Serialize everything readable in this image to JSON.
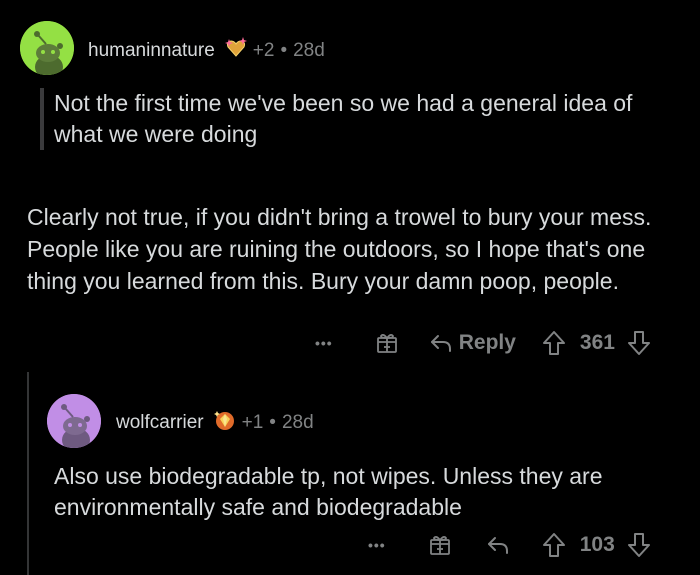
{
  "comment1": {
    "username": "humaninnature",
    "award_count": "+2",
    "separator": "•",
    "age": "28d",
    "quote": "Not the first time we've been so we had a general idea of what we were doing",
    "body": "Clearly not true, if you didn't bring a trowel to bury your mess. People like you are ruining the outdoors, so I hope that's one thing you learned from this. Bury your damn poop, people.",
    "more_label": "•••",
    "reply_label": "Reply",
    "score": "361",
    "avatar_color": "#94e044",
    "award_icon": "sparkle-heart-award-icon"
  },
  "comment2": {
    "username": "wolfcarrier",
    "award_count": "+1",
    "separator": "•",
    "age": "28d",
    "body": "Also use biodegradable tp, not wipes. Unless they are environmentally safe and biodegradable",
    "more_label": "•••",
    "score": "103",
    "avatar_color": "#c18ee6",
    "award_icon": "gem-award-icon"
  },
  "colors": {
    "background": "#000000",
    "text": "#d7dadc",
    "muted": "#818384",
    "thread_line": "#343536"
  }
}
